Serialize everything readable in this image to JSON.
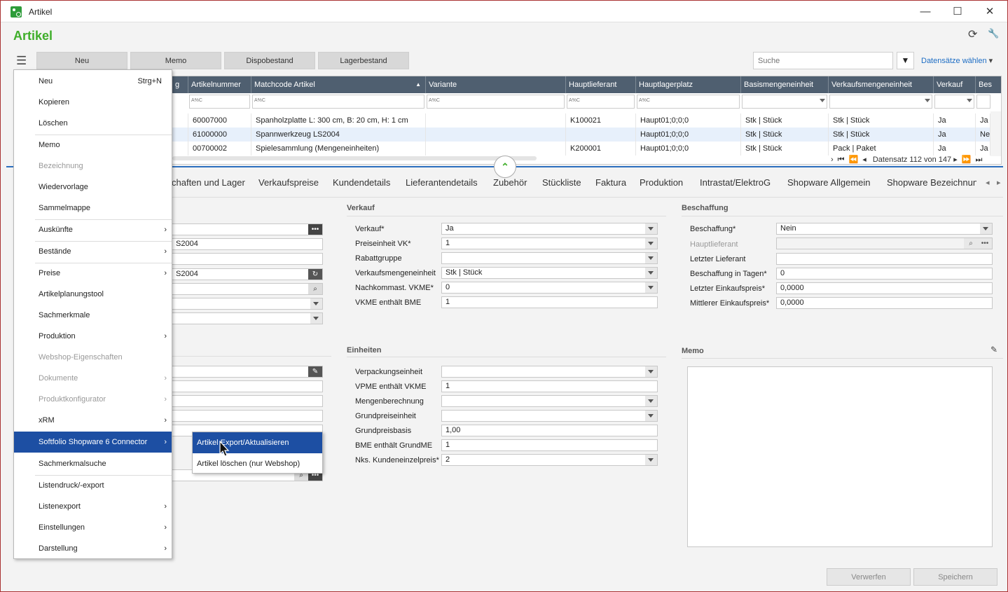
{
  "window": {
    "title": "Artikel",
    "minimize": "—",
    "maximize": "☐",
    "close": "✕"
  },
  "header": {
    "title": "Artikel",
    "refresh_icon": "refresh-icon",
    "settings_icon": "wrench-icon"
  },
  "toolbar": {
    "menu_icon": "☰",
    "buttons": [
      "Neu",
      "Memo",
      "Dispobestand",
      "Lagerbestand"
    ],
    "search_placeholder": "Suche",
    "filter_icon": "▼",
    "select_records": "Datensätze wählen"
  },
  "grid": {
    "columns": [
      "g",
      "Artikelnummer",
      "Matchcode Artikel",
      "Variante",
      "Hauptlieferant",
      "Hauptlagerplatz",
      "Basismengeneinheit",
      "Verkaufsmengeneinheit",
      "Verkauf",
      "Bes"
    ],
    "rows": [
      [
        "",
        "60007000",
        "Spanholzplatte L: 300 cm, B: 20 cm, H: 1 cm",
        "",
        "K100021",
        "Haupt01;0;0;0",
        "Stk  |  Stück",
        "Stk  |  Stück",
        "Ja",
        "Ja"
      ],
      [
        "",
        "61000000",
        "Spannwerkzeug LS2004",
        "",
        "",
        "Haupt01;0;0;0",
        "Stk  |  Stück",
        "Stk  |  Stück",
        "Ja",
        "Ne"
      ],
      [
        "",
        "00700002",
        "Spielesammlung (Mengeneinheiten)",
        "",
        "K200001",
        "Haupt01;0;0;0",
        "Stk  |  Stück",
        "Pack  |  Paket",
        "Ja",
        "Ja"
      ]
    ],
    "pager": "Datensatz 112 von 147"
  },
  "tabs": [
    "chaften und Lager",
    "Verkaufspreise",
    "Kundendetails",
    "Lieferantendetails",
    "Zubehör",
    "Stückliste",
    "Faktura",
    "Produktion",
    "Intrastat/ElektroG",
    "Shopware Allgemein",
    "Shopware Bezeichnun"
  ],
  "left_fields": {
    "f2": "S2004",
    "f4": "S2004"
  },
  "verkauf": {
    "title": "Verkauf",
    "fields": [
      {
        "label": "Verkauf*",
        "value": "Ja"
      },
      {
        "label": "Preiseinheit VK*",
        "value": "1"
      },
      {
        "label": "Rabattgruppe",
        "value": ""
      },
      {
        "label": "Verkaufsmengeneinheit",
        "value": "Stk  |  Stück"
      },
      {
        "label": "Nachkommast. VKME*",
        "value": "0"
      },
      {
        "label": "VKME enthält BME",
        "value": "1"
      }
    ]
  },
  "beschaffung": {
    "title": "Beschaffung",
    "fields": [
      {
        "label": "Beschaffung*",
        "value": "Nein"
      },
      {
        "label": "Hauptlieferant",
        "value": ""
      },
      {
        "label": "Letzter Lieferant",
        "value": ""
      },
      {
        "label": "Beschaffung in Tagen*",
        "value": "0"
      },
      {
        "label": "Letzter Einkaufspreis*",
        "value": "0,0000"
      },
      {
        "label": "Mittlerer Einkaufspreis*",
        "value": "0,0000"
      }
    ]
  },
  "einheiten": {
    "title": "Einheiten",
    "fields": [
      {
        "label": "Verpackungseinheit",
        "value": ""
      },
      {
        "label": "VPME enthält VKME",
        "value": "1"
      },
      {
        "label": "Mengenberechnung",
        "value": ""
      },
      {
        "label": "Grundpreiseinheit",
        "value": ""
      },
      {
        "label": "Grundpreisbasis",
        "value": "1,00"
      },
      {
        "label": "BME enthält GrundME",
        "value": "1"
      },
      {
        "label": "Nks. Kundeneinzelpreis*",
        "value": "2"
      }
    ]
  },
  "memo": {
    "title": "Memo"
  },
  "footer": {
    "discard": "Verwerfen",
    "save": "Speichern"
  },
  "menu": {
    "items": [
      {
        "label": "Neu",
        "shortcut": "Strg+N"
      },
      {
        "label": "Kopieren"
      },
      {
        "label": "Löschen"
      },
      {
        "label": "Memo"
      },
      {
        "label": "Bezeichnung"
      },
      {
        "label": "Wiedervorlage"
      },
      {
        "label": "Sammelmappe"
      },
      {
        "label": "Auskünfte",
        "arrow": "›"
      },
      {
        "label": "Bestände",
        "arrow": "›"
      },
      {
        "label": "Preise",
        "arrow": "›"
      },
      {
        "label": "Artikelplanungstool"
      },
      {
        "label": "Sachmerkmale"
      },
      {
        "label": "Produktion",
        "arrow": "›"
      },
      {
        "label": "Webshop-Eigenschaften"
      },
      {
        "label": "Dokumente",
        "arrow": "›"
      },
      {
        "label": "Produktkonfigurator",
        "arrow": "›"
      },
      {
        "label": "xRM",
        "arrow": "›"
      },
      {
        "label": "Softfolio Shopware 6 Connector",
        "arrow": "›"
      },
      {
        "label": "Sachmerkmalsuche"
      },
      {
        "label": "Listendruck/-export"
      },
      {
        "label": "Listenexport",
        "arrow": "›"
      },
      {
        "label": "Einstellungen",
        "arrow": "›"
      },
      {
        "label": "Darstellung",
        "arrow": "›"
      }
    ]
  },
  "submenu": {
    "items": [
      "Artikel Export/Aktualisieren",
      "Artikel löschen (nur Webshop)"
    ]
  }
}
